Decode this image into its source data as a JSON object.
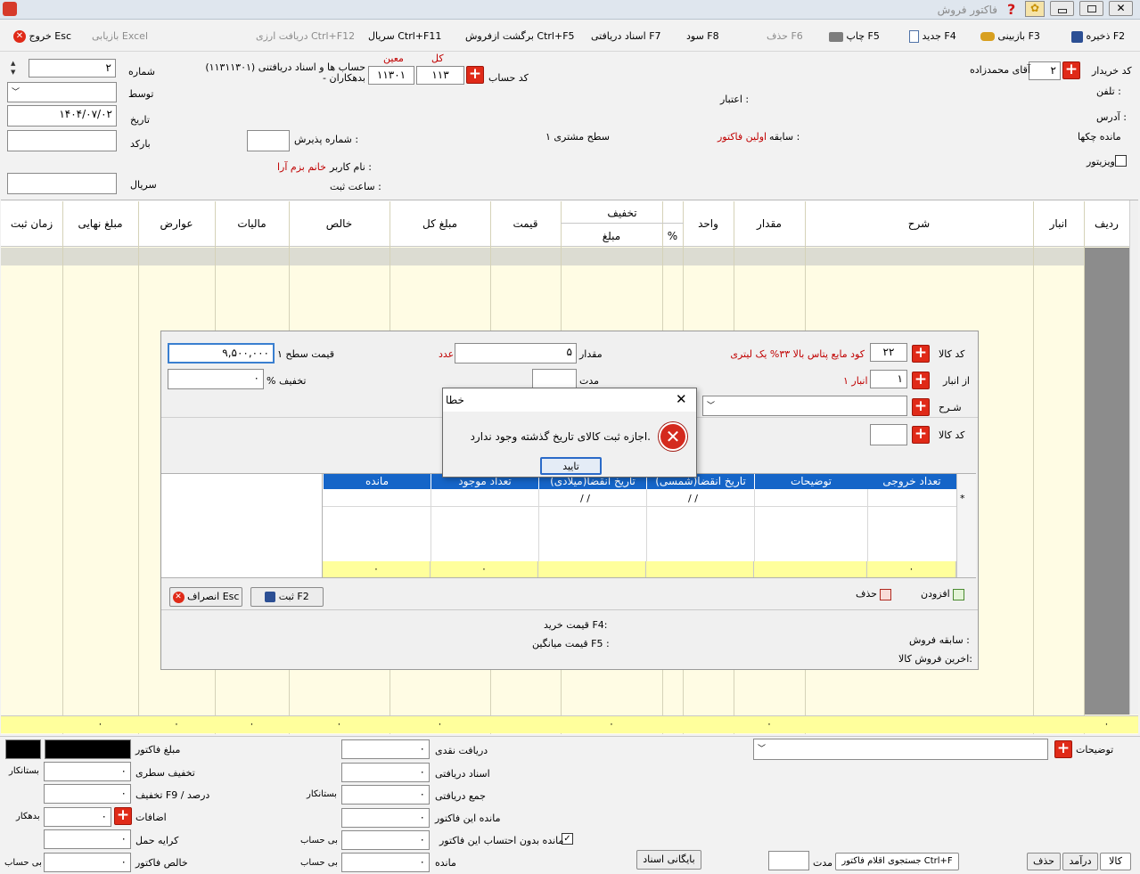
{
  "window": {
    "title": "فاکتور فروش"
  },
  "toolbar": {
    "save": "ذخیره F2",
    "recover": "بازبینی F3",
    "new": "جدید F4",
    "print": "چاپ F5",
    "delete": "حذف F6",
    "profit": "سود F8",
    "received_docs": "اسناد دریافتی F7",
    "return_sale": "برگشت ازفروش Ctrl+F5",
    "serial": "سریال Ctrl+F11",
    "currency": "دریافت ارزی Ctrl+F12",
    "excel": "بازیابی Excel",
    "exit": "خروج Esc"
  },
  "header": {
    "buyer_code_label": "کد خریدار",
    "buyer_code": "۲",
    "buyer_name": "آقای محمدزاده",
    "phone_label": "تلفن :",
    "address_label": "آدرس :",
    "cheques_label": "مانده چکها",
    "visitor_label": "ویزیتور",
    "account_label": "کد حساب",
    "kol_label": "کل",
    "moein_label": "معین",
    "kol": "۱۱۳",
    "moein": "۱۱۳۰۱",
    "account_desc1": "(۱۱۳۱۱۳۰۱) حساب ها و اسناد دریافتنی",
    "account_desc2": "- بدهکاران",
    "credit_label": "اعتبار :",
    "history_label": "سابقه :",
    "history_value": "اولین فاکتور",
    "level_label": "سطح مشتری ۱",
    "reception_label": "شماره پذیرش :",
    "user_label": "نام کاربر :",
    "user_value": "خانم بزم آرا",
    "reg_time_label": "ساعت ثبت :",
    "number_label": "شماره",
    "number": "۲",
    "by_label": "توسط",
    "date_label": "تاریخ",
    "date": "۱۴۰۴/۰۷/۰۲",
    "barcode_label": "بارکد",
    "serial_label": "سریال"
  },
  "grid": {
    "cols": [
      "ردیف",
      "انبار",
      "شرح",
      "مقدار",
      "واحد",
      "%",
      "مبلغ",
      "قیمت",
      "مبلغ کل",
      "خالص",
      "مالیات",
      "عوارض",
      "مبلغ نهایی",
      "زمان ثبت"
    ],
    "discount_label": "تخفیف",
    "zero": "۰"
  },
  "item_panel": {
    "code_label": "کد کالا",
    "code": "۲۲",
    "item_name": "کود مایع پتاس بالا ۳۳% یک لیتری",
    "qty_label": "مقدار",
    "qty": "۵",
    "unit": "عدد",
    "price_label": "قیمت سطح ۱",
    "price": "۹,۵۰۰,۰۰۰",
    "store_label": "از انبار",
    "store": "۱",
    "store_name": "انبار ۱",
    "duration_label": "مدت",
    "discount_label": "% تخفیف",
    "discount": "۰",
    "desc_label": "شـرح",
    "code2_label": "کد کالا",
    "table_cols": [
      "تعداد خروجی",
      "توضیحات",
      "تاریخ انقضا(شمسی)",
      "تاریخ انقضا(میلادی)",
      "تعداد موجود",
      "مانده"
    ],
    "date_placeholder": "/  /",
    "zero": "۰",
    "add": "افزودن",
    "remove": "حذف",
    "register": "ثبت  F2",
    "cancel": "انصراف  Esc",
    "sale_history": "سابقه فروش :",
    "last_sale": "اخرین فروش کالا:",
    "buy_price": "قیمت خرید F4:",
    "avg_price": "قیمت میانگین F5 :"
  },
  "dialog": {
    "title": "خطا",
    "message": "اجازه ثبت کالای تاریخ گذشته وجود ندارد.",
    "ok": "تایید"
  },
  "footer": {
    "notes_label": "توضیحات",
    "invoice_amount": "مبلغ فاکتور",
    "line_discount": "تخفیف سطری",
    "discount_pct": "تخفیف F9 / درصد",
    "additions": "اضافات",
    "freight": "کرایه حمل",
    "net_invoice": "خالص فاکتور",
    "cash": "دریافت نقدی",
    "docs": "اسناد دریافتی",
    "total_received": "جمع دریافتی",
    "invoice_balance": "مانده این فاکتور",
    "balance_excl": "مانده بدون احتساب این فاکتور",
    "balance": "مانده",
    "zero": "۰",
    "creditor": "بستانکار",
    "debtor": "بدهکار",
    "no_account": "بی حساب",
    "archive": "بایگانی اسناد",
    "duration": "مدت",
    "search": "جستجوی اقلام فاکتور Ctrl+F",
    "goods": "کالا",
    "income": "درآمد",
    "delete": "حذف"
  }
}
